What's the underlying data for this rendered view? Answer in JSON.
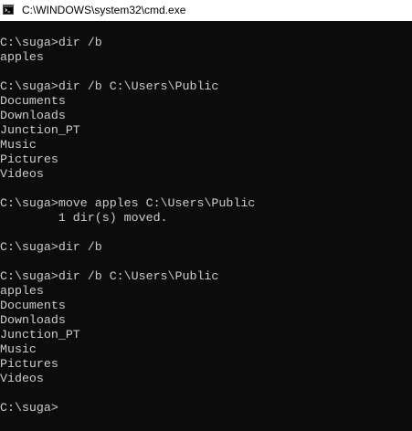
{
  "window": {
    "title": "C:\\WINDOWS\\system32\\cmd.exe",
    "icon": "cmd-app-icon"
  },
  "console": {
    "lines": [
      "",
      "C:\\suga>dir /b",
      "apples",
      "",
      "C:\\suga>dir /b C:\\Users\\Public",
      "Documents",
      "Downloads",
      "Junction_PT",
      "Music",
      "Pictures",
      "Videos",
      "",
      "C:\\suga>move apples C:\\Users\\Public",
      "        1 dir(s) moved.",
      "",
      "C:\\suga>dir /b",
      "",
      "C:\\suga>dir /b C:\\Users\\Public",
      "apples",
      "Documents",
      "Downloads",
      "Junction_PT",
      "Music",
      "Pictures",
      "Videos",
      "",
      "C:\\suga>"
    ]
  },
  "colors": {
    "background": "#0c0c0c",
    "foreground": "#cccccc",
    "titlebar": "#ffffff"
  }
}
